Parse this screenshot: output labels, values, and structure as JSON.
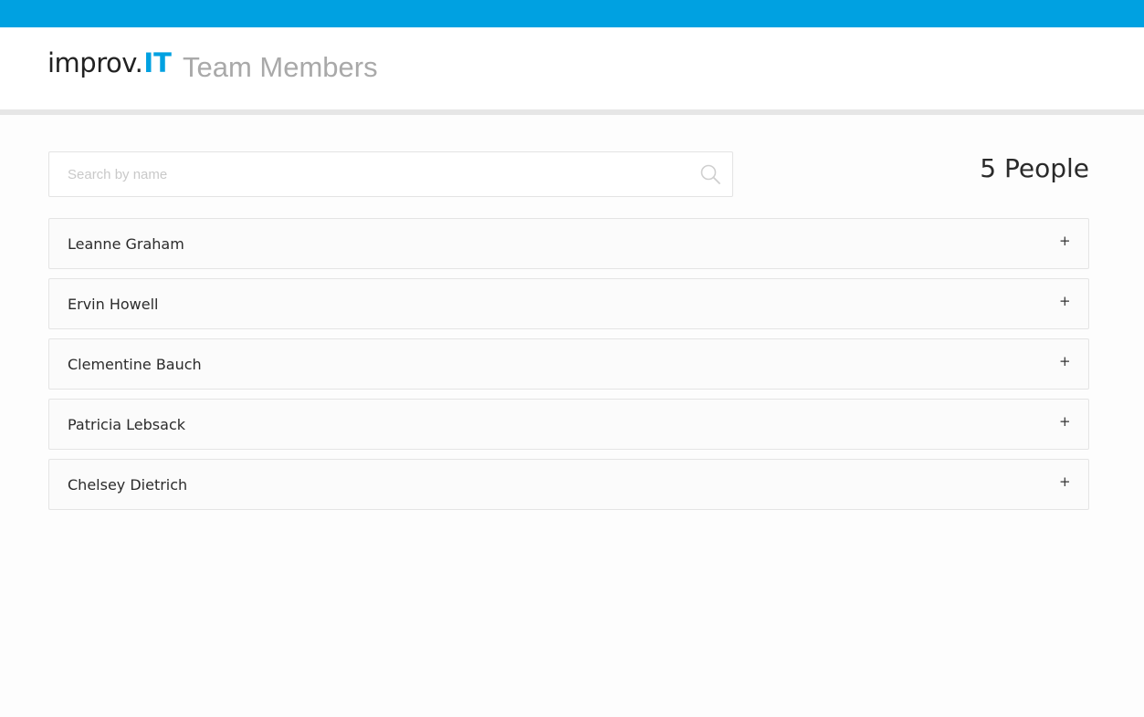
{
  "header": {
    "logo_main": "improv.",
    "logo_accent": "IT",
    "title": "Team Members"
  },
  "search": {
    "placeholder": "Search by name",
    "value": ""
  },
  "summary": {
    "count_label": "5 People"
  },
  "members": [
    {
      "name": "Leanne Graham",
      "expand": "+"
    },
    {
      "name": "Ervin Howell",
      "expand": "+"
    },
    {
      "name": "Clementine Bauch",
      "expand": "+"
    },
    {
      "name": "Patricia Lebsack",
      "expand": "+"
    },
    {
      "name": "Chelsey Dietrich",
      "expand": "+"
    }
  ],
  "colors": {
    "accent": "#00a1e1",
    "title_gray": "#a9a9a9"
  },
  "icons": {
    "search": "search-icon",
    "expand": "plus-icon"
  }
}
